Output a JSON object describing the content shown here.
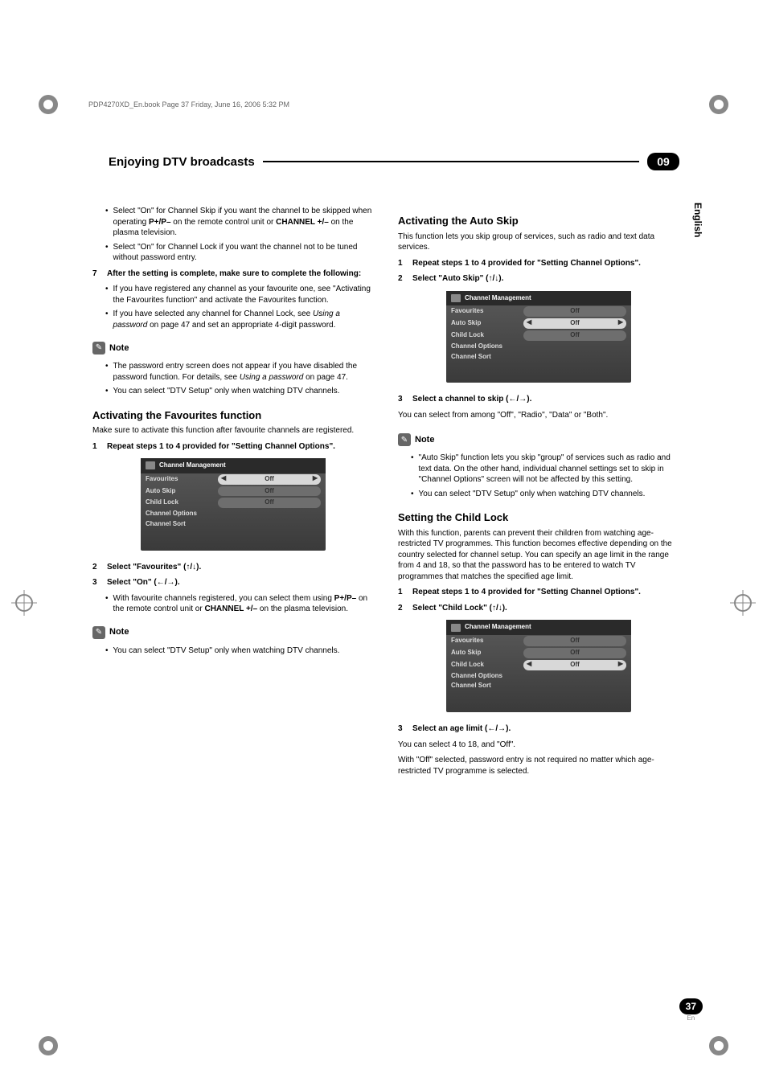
{
  "header_stamp": "PDP4270XD_En.book  Page 37  Friday, June 16, 2006  5:32 PM",
  "title": "Enjoying DTV broadcasts",
  "chapter": "09",
  "language_tab": "English",
  "page_number": "37",
  "page_lang": "En",
  "left": {
    "b1": "Select \"On\" for Channel Skip if you want the channel to be skipped when operating ",
    "b1b": "P+/P–",
    "b1c": " on the remote control unit or ",
    "b1d": "CHANNEL +/–",
    "b1e": " on the plasma television.",
    "b2": "Select \"On\" for Channel Lock if you want the channel not to be tuned without password entry.",
    "step7n": "7",
    "step7t": "After the setting is complete, make sure to complete the following:",
    "b3": "If you have registered any channel as your favourite one, see \"Activating the Favourites function\" and activate the Favourites function.",
    "b4a": "If you have selected any channel for Channel Lock, see ",
    "b4b": "Using a password",
    "b4c": " on page 47 and set an appropriate 4-digit password.",
    "note": "Note",
    "n1a": "The password entry screen does not appear if you have disabled the password function. For details, see ",
    "n1b": "Using a password",
    "n1c": " on page 47.",
    "n2": "You can select \"DTV Setup\" only when watching DTV channels.",
    "sec1": "Activating the Favourites function",
    "sec1_sub": "Make sure to activate this function after favourite channels are registered.",
    "s1n": "1",
    "s1t": "Repeat steps 1 to 4 provided for \"Setting Channel Options\".",
    "s2n": "2",
    "s2t": "Select \"Favourites\" (↑/↓).",
    "s3n": "3",
    "s3t": "Select \"On\" (←/→).",
    "b5a": "With favourite channels registered, you can select them using ",
    "b5b": "P+/P–",
    "b5c": " on the remote control unit or ",
    "b5d": "CHANNEL +/–",
    "b5e": " on the plasma television.",
    "n3": "You can select \"DTV Setup\" only when watching DTV channels."
  },
  "right": {
    "sec1": "Activating the Auto Skip",
    "sec1_sub": "This function lets you skip group of services, such as radio and text data services.",
    "s1n": "1",
    "s1t": "Repeat steps 1 to 4 provided for \"Setting Channel Options\".",
    "s2n": "2",
    "s2t": "Select \"Auto Skip\" (↑/↓).",
    "s3n": "3",
    "s3t": "Select a channel to skip (←/→).",
    "s3sub": "You can select from among \"Off\", \"Radio\", \"Data\" or \"Both\".",
    "note": "Note",
    "n1": "\"Auto Skip\" function lets you skip \"group\" of services such as radio and text data. On the other hand, individual channel settings set to skip in \"Channel Options\" screen will not be affected by this setting.",
    "n2": "You can select \"DTV Setup\" only when watching DTV channels.",
    "sec2": "Setting the Child Lock",
    "sec2_sub": "With this function, parents can prevent their children from watching age-restricted TV programmes. This function becomes effective depending on the country selected for channel setup. You can specify an age limit in the range from 4 and 18, so that the password has to be entered to watch TV programmes that matches the specified age limit.",
    "cs1n": "1",
    "cs1t": "Repeat steps 1 to 4 provided for \"Setting Channel Options\".",
    "cs2n": "2",
    "cs2t": "Select \"Child Lock\" (↑/↓).",
    "cs3n": "3",
    "cs3t": "Select an age limit (←/→).",
    "cs3sub": "You can select 4 to 18, and \"Off\".",
    "cs3sub2": "With \"Off\" selected, password entry is not required no matter which age-restricted TV programme is selected."
  },
  "menu": {
    "title": "Channel Management",
    "rows": {
      "fav": "Favourites",
      "auto": "Auto Skip",
      "child": "Child Lock",
      "opt": "Channel Options",
      "sort": "Channel Sort"
    },
    "off": "Off"
  }
}
